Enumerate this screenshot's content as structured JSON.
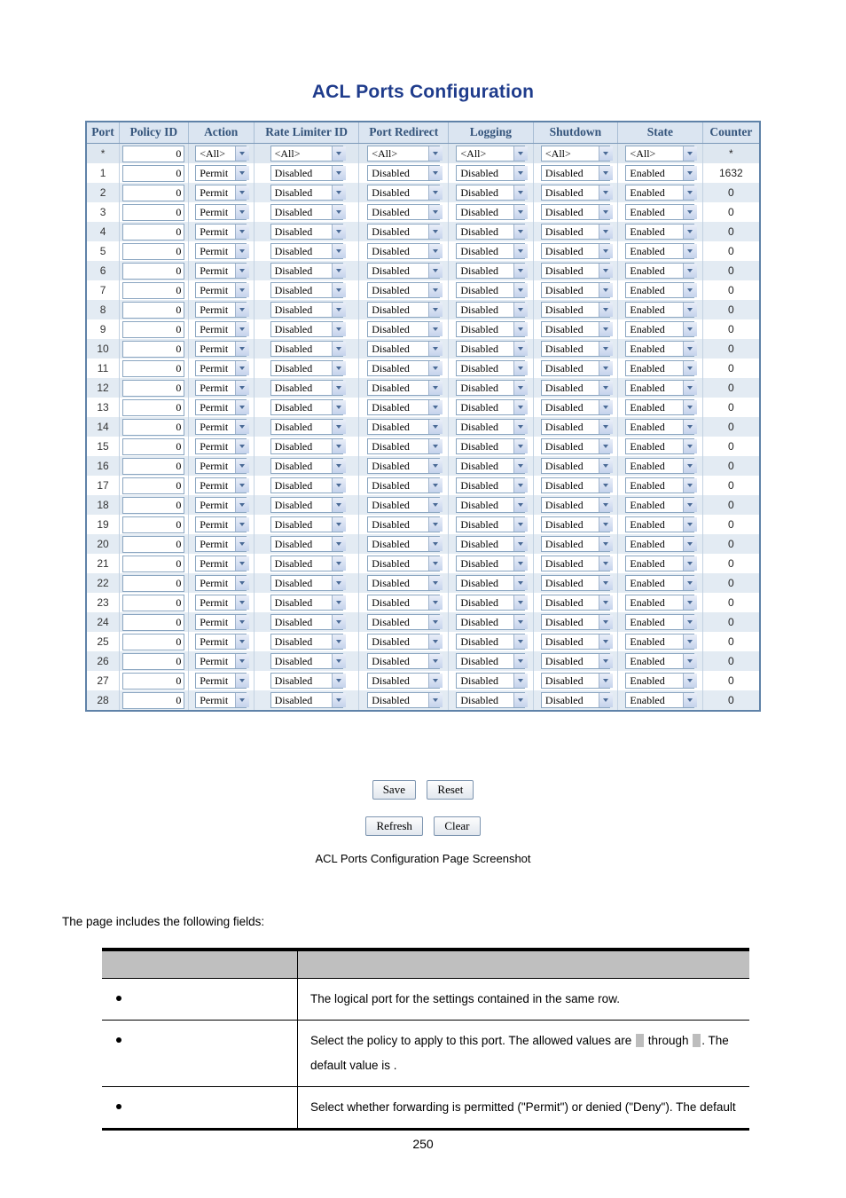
{
  "document": {
    "screenshot_title": "ACL Ports Configuration",
    "caption": "ACL Ports Configuration Page Screenshot",
    "intro_text": "The page includes the following fields:",
    "page_number": "250"
  },
  "acl_table": {
    "columns": [
      {
        "key": "port",
        "label": "Port"
      },
      {
        "key": "policy_id",
        "label": "Policy ID"
      },
      {
        "key": "action",
        "label": "Action"
      },
      {
        "key": "rate_limiter_id",
        "label": "Rate Limiter ID"
      },
      {
        "key": "port_redirect",
        "label": "Port Redirect"
      },
      {
        "key": "logging",
        "label": "Logging"
      },
      {
        "key": "shutdown",
        "label": "Shutdown"
      },
      {
        "key": "state",
        "label": "State"
      },
      {
        "key": "counter",
        "label": "Counter"
      }
    ],
    "all_option_label": "<All>",
    "rows": [
      {
        "port": "*",
        "policy_id": "0",
        "action": "<All>",
        "rate_limiter_id": "<All>",
        "port_redirect": "<All>",
        "logging": "<All>",
        "shutdown": "<All>",
        "state": "<All>",
        "counter": "*"
      },
      {
        "port": "1",
        "policy_id": "0",
        "action": "Permit",
        "rate_limiter_id": "Disabled",
        "port_redirect": "Disabled",
        "logging": "Disabled",
        "shutdown": "Disabled",
        "state": "Enabled",
        "counter": "1632"
      },
      {
        "port": "2",
        "policy_id": "0",
        "action": "Permit",
        "rate_limiter_id": "Disabled",
        "port_redirect": "Disabled",
        "logging": "Disabled",
        "shutdown": "Disabled",
        "state": "Enabled",
        "counter": "0"
      },
      {
        "port": "3",
        "policy_id": "0",
        "action": "Permit",
        "rate_limiter_id": "Disabled",
        "port_redirect": "Disabled",
        "logging": "Disabled",
        "shutdown": "Disabled",
        "state": "Enabled",
        "counter": "0"
      },
      {
        "port": "4",
        "policy_id": "0",
        "action": "Permit",
        "rate_limiter_id": "Disabled",
        "port_redirect": "Disabled",
        "logging": "Disabled",
        "shutdown": "Disabled",
        "state": "Enabled",
        "counter": "0"
      },
      {
        "port": "5",
        "policy_id": "0",
        "action": "Permit",
        "rate_limiter_id": "Disabled",
        "port_redirect": "Disabled",
        "logging": "Disabled",
        "shutdown": "Disabled",
        "state": "Enabled",
        "counter": "0"
      },
      {
        "port": "6",
        "policy_id": "0",
        "action": "Permit",
        "rate_limiter_id": "Disabled",
        "port_redirect": "Disabled",
        "logging": "Disabled",
        "shutdown": "Disabled",
        "state": "Enabled",
        "counter": "0"
      },
      {
        "port": "7",
        "policy_id": "0",
        "action": "Permit",
        "rate_limiter_id": "Disabled",
        "port_redirect": "Disabled",
        "logging": "Disabled",
        "shutdown": "Disabled",
        "state": "Enabled",
        "counter": "0"
      },
      {
        "port": "8",
        "policy_id": "0",
        "action": "Permit",
        "rate_limiter_id": "Disabled",
        "port_redirect": "Disabled",
        "logging": "Disabled",
        "shutdown": "Disabled",
        "state": "Enabled",
        "counter": "0"
      },
      {
        "port": "9",
        "policy_id": "0",
        "action": "Permit",
        "rate_limiter_id": "Disabled",
        "port_redirect": "Disabled",
        "logging": "Disabled",
        "shutdown": "Disabled",
        "state": "Enabled",
        "counter": "0"
      },
      {
        "port": "10",
        "policy_id": "0",
        "action": "Permit",
        "rate_limiter_id": "Disabled",
        "port_redirect": "Disabled",
        "logging": "Disabled",
        "shutdown": "Disabled",
        "state": "Enabled",
        "counter": "0"
      },
      {
        "port": "11",
        "policy_id": "0",
        "action": "Permit",
        "rate_limiter_id": "Disabled",
        "port_redirect": "Disabled",
        "logging": "Disabled",
        "shutdown": "Disabled",
        "state": "Enabled",
        "counter": "0"
      },
      {
        "port": "12",
        "policy_id": "0",
        "action": "Permit",
        "rate_limiter_id": "Disabled",
        "port_redirect": "Disabled",
        "logging": "Disabled",
        "shutdown": "Disabled",
        "state": "Enabled",
        "counter": "0"
      },
      {
        "port": "13",
        "policy_id": "0",
        "action": "Permit",
        "rate_limiter_id": "Disabled",
        "port_redirect": "Disabled",
        "logging": "Disabled",
        "shutdown": "Disabled",
        "state": "Enabled",
        "counter": "0"
      },
      {
        "port": "14",
        "policy_id": "0",
        "action": "Permit",
        "rate_limiter_id": "Disabled",
        "port_redirect": "Disabled",
        "logging": "Disabled",
        "shutdown": "Disabled",
        "state": "Enabled",
        "counter": "0"
      },
      {
        "port": "15",
        "policy_id": "0",
        "action": "Permit",
        "rate_limiter_id": "Disabled",
        "port_redirect": "Disabled",
        "logging": "Disabled",
        "shutdown": "Disabled",
        "state": "Enabled",
        "counter": "0"
      },
      {
        "port": "16",
        "policy_id": "0",
        "action": "Permit",
        "rate_limiter_id": "Disabled",
        "port_redirect": "Disabled",
        "logging": "Disabled",
        "shutdown": "Disabled",
        "state": "Enabled",
        "counter": "0"
      },
      {
        "port": "17",
        "policy_id": "0",
        "action": "Permit",
        "rate_limiter_id": "Disabled",
        "port_redirect": "Disabled",
        "logging": "Disabled",
        "shutdown": "Disabled",
        "state": "Enabled",
        "counter": "0"
      },
      {
        "port": "18",
        "policy_id": "0",
        "action": "Permit",
        "rate_limiter_id": "Disabled",
        "port_redirect": "Disabled",
        "logging": "Disabled",
        "shutdown": "Disabled",
        "state": "Enabled",
        "counter": "0"
      },
      {
        "port": "19",
        "policy_id": "0",
        "action": "Permit",
        "rate_limiter_id": "Disabled",
        "port_redirect": "Disabled",
        "logging": "Disabled",
        "shutdown": "Disabled",
        "state": "Enabled",
        "counter": "0"
      },
      {
        "port": "20",
        "policy_id": "0",
        "action": "Permit",
        "rate_limiter_id": "Disabled",
        "port_redirect": "Disabled",
        "logging": "Disabled",
        "shutdown": "Disabled",
        "state": "Enabled",
        "counter": "0"
      },
      {
        "port": "21",
        "policy_id": "0",
        "action": "Permit",
        "rate_limiter_id": "Disabled",
        "port_redirect": "Disabled",
        "logging": "Disabled",
        "shutdown": "Disabled",
        "state": "Enabled",
        "counter": "0"
      },
      {
        "port": "22",
        "policy_id": "0",
        "action": "Permit",
        "rate_limiter_id": "Disabled",
        "port_redirect": "Disabled",
        "logging": "Disabled",
        "shutdown": "Disabled",
        "state": "Enabled",
        "counter": "0"
      },
      {
        "port": "23",
        "policy_id": "0",
        "action": "Permit",
        "rate_limiter_id": "Disabled",
        "port_redirect": "Disabled",
        "logging": "Disabled",
        "shutdown": "Disabled",
        "state": "Enabled",
        "counter": "0"
      },
      {
        "port": "24",
        "policy_id": "0",
        "action": "Permit",
        "rate_limiter_id": "Disabled",
        "port_redirect": "Disabled",
        "logging": "Disabled",
        "shutdown": "Disabled",
        "state": "Enabled",
        "counter": "0"
      },
      {
        "port": "25",
        "policy_id": "0",
        "action": "Permit",
        "rate_limiter_id": "Disabled",
        "port_redirect": "Disabled",
        "logging": "Disabled",
        "shutdown": "Disabled",
        "state": "Enabled",
        "counter": "0"
      },
      {
        "port": "26",
        "policy_id": "0",
        "action": "Permit",
        "rate_limiter_id": "Disabled",
        "port_redirect": "Disabled",
        "logging": "Disabled",
        "shutdown": "Disabled",
        "state": "Enabled",
        "counter": "0"
      },
      {
        "port": "27",
        "policy_id": "0",
        "action": "Permit",
        "rate_limiter_id": "Disabled",
        "port_redirect": "Disabled",
        "logging": "Disabled",
        "shutdown": "Disabled",
        "state": "Enabled",
        "counter": "0"
      },
      {
        "port": "28",
        "policy_id": "0",
        "action": "Permit",
        "rate_limiter_id": "Disabled",
        "port_redirect": "Disabled",
        "logging": "Disabled",
        "shutdown": "Disabled",
        "state": "Enabled",
        "counter": "0"
      }
    ]
  },
  "buttons": {
    "save": "Save",
    "reset": "Reset",
    "refresh": "Refresh",
    "clear": "Clear"
  },
  "fields_table": {
    "headers": {
      "object": "",
      "description": ""
    },
    "rows": [
      {
        "name": "",
        "desc_parts": [
          {
            "t": "text",
            "v": "The logical port for the settings contained in the same row."
          }
        ]
      },
      {
        "name": "",
        "desc_parts": [
          {
            "t": "text",
            "v": "Select the policy to apply to this port. The allowed values are "
          },
          {
            "t": "placeholder"
          },
          {
            "t": "text",
            "v": " through "
          },
          {
            "t": "placeholder"
          },
          {
            "t": "text",
            "v": ". The default value is   ."
          }
        ]
      },
      {
        "name": "",
        "desc_parts": [
          {
            "t": "text",
            "v": "Select whether forwarding is permitted (\"Permit\") or denied (\"Deny\"). The default"
          }
        ]
      }
    ]
  },
  "colors": {
    "title": "#1f3c8c",
    "table_border": "#5f82a8",
    "header_bg": "#dbe5f1",
    "header_text": "#33537a",
    "row_alt_bg": "#e3ebf3",
    "field_header_bg": "#bfbfbf",
    "placeholder_bg": "#bdbdbd"
  }
}
